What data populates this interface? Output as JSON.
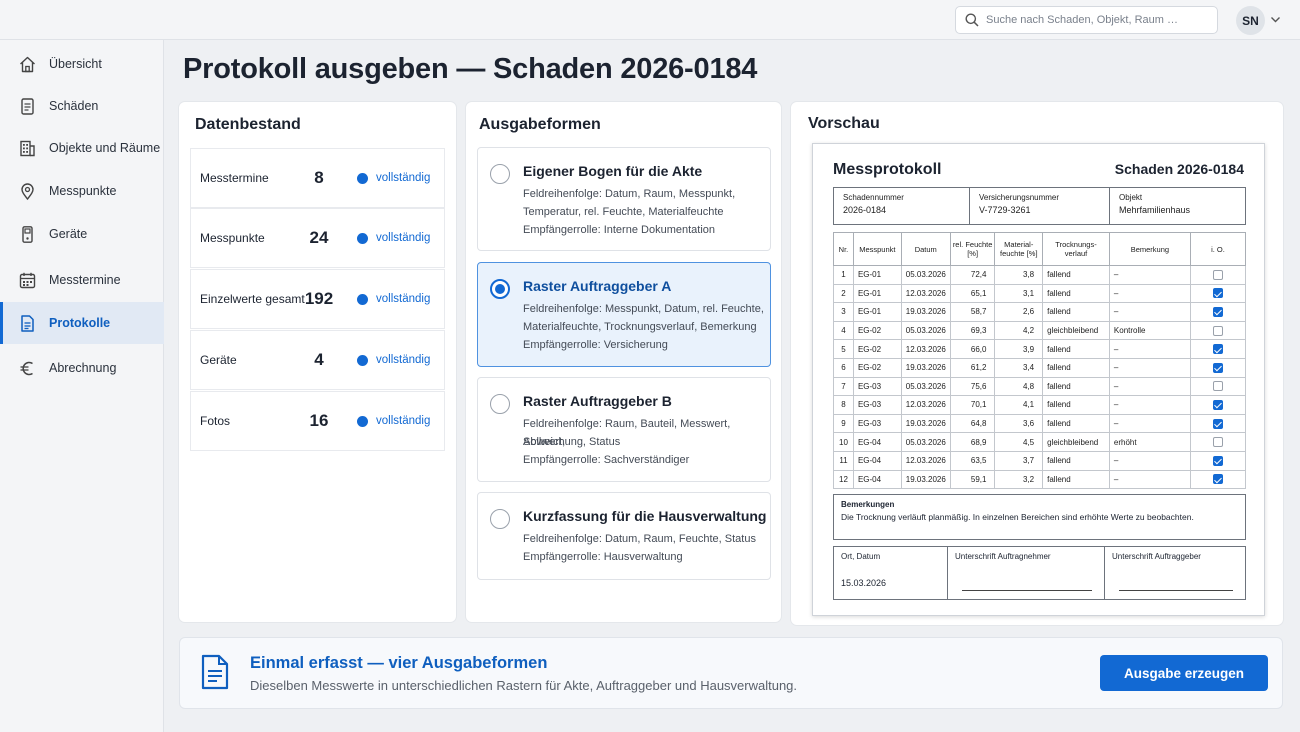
{
  "search": {
    "placeholder": "Suche nach Schaden, Objekt, Raum …"
  },
  "user": {
    "initials": "SN"
  },
  "sidebar": {
    "items": [
      {
        "label": "Übersicht",
        "icon": "home-icon"
      },
      {
        "label": "Schäden",
        "icon": "document-icon"
      },
      {
        "label": "Objekte und Räume",
        "icon": "building-icon"
      },
      {
        "label": "Messpunkte",
        "icon": "location-pin-icon"
      },
      {
        "label": "Geräte",
        "icon": "device-icon"
      },
      {
        "label": "Messtermine",
        "icon": "calendar-icon"
      },
      {
        "label": "Protokolle",
        "icon": "protocol-icon",
        "active": true
      },
      {
        "label": "Abrechnung",
        "icon": "euro-icon"
      }
    ]
  },
  "page": {
    "title": "Protokoll ausgeben — Schaden 2026-0184"
  },
  "datenbestand": {
    "title": "Datenbestand",
    "rows": [
      {
        "label": "Messtermine",
        "value": "8",
        "status": "vollständig"
      },
      {
        "label": "Messpunkte",
        "value": "24",
        "status": "vollständig"
      },
      {
        "label": "Einzelwerte gesamt",
        "value": "192",
        "status": "vollständig"
      },
      {
        "label": "Geräte",
        "value": "4",
        "status": "vollständig"
      },
      {
        "label": "Fotos",
        "value": "16",
        "status": "vollständig"
      }
    ]
  },
  "ausgabeformen": {
    "title": "Ausgabeformen",
    "options": [
      {
        "title": "Eigener Bogen für die Akte",
        "fields_1": "Feldreihenfolge: Datum, Raum, Messpunkt,",
        "fields_2": "Temperatur, rel. Feuchte, Materialfeuchte",
        "role": "Empfängerrolle: Interne Dokumentation",
        "selected": false
      },
      {
        "title": "Raster Auftraggeber A",
        "fields_1": "Feldreihenfolge: Messpunkt, Datum, rel. Feuchte,",
        "fields_2": "Materialfeuchte, Trocknungsverlauf, Bemerkung",
        "role": "Empfängerrolle: Versicherung",
        "selected": true
      },
      {
        "title": "Raster Auftraggeber B",
        "fields_1": "Feldreihenfolge: Raum, Bauteil, Messwert, Sollwert,",
        "fields_2": "Abweichung, Status",
        "role": "Empfängerrolle: Sachverständiger",
        "selected": false
      },
      {
        "title": "Kurzfassung für die Hausverwaltung",
        "fields_1": "Feldreihenfolge: Datum, Raum, Feuchte, Status",
        "fields_2": "",
        "role": "Empfängerrolle: Hausverwaltung",
        "selected": false
      }
    ]
  },
  "preview": {
    "title": "Vorschau",
    "doc_title": "Messprotokoll",
    "doc_case": "Schaden 2026-0184",
    "meta": [
      {
        "key": "Schadennummer",
        "value": "2026-0184"
      },
      {
        "key": "Versicherungsnummer",
        "value": "V-7729-3261"
      },
      {
        "key": "Objekt",
        "value": "Mehrfamilienhaus"
      }
    ],
    "columns": [
      "Nr.",
      "Messpunkt",
      "Datum",
      "rel. Feuchte [%]",
      "Material-feuchte [%]",
      "Trocknungs-verlauf",
      "Bemerkung",
      "i. O."
    ],
    "rows": [
      {
        "nr": "1",
        "mp": "EG-01",
        "date": "05.03.2026",
        "rh": "72,4",
        "mf": "3,8",
        "trend": "fallend",
        "note": "–",
        "ok": false
      },
      {
        "nr": "2",
        "mp": "EG-01",
        "date": "12.03.2026",
        "rh": "65,1",
        "mf": "3,1",
        "trend": "fallend",
        "note": "–",
        "ok": true
      },
      {
        "nr": "3",
        "mp": "EG-01",
        "date": "19.03.2026",
        "rh": "58,7",
        "mf": "2,6",
        "trend": "fallend",
        "note": "–",
        "ok": true
      },
      {
        "nr": "4",
        "mp": "EG-02",
        "date": "05.03.2026",
        "rh": "69,3",
        "mf": "4,2",
        "trend": "gleichbleibend",
        "note": "Kontrolle",
        "ok": false
      },
      {
        "nr": "5",
        "mp": "EG-02",
        "date": "12.03.2026",
        "rh": "66,0",
        "mf": "3,9",
        "trend": "fallend",
        "note": "–",
        "ok": true
      },
      {
        "nr": "6",
        "mp": "EG-02",
        "date": "19.03.2026",
        "rh": "61,2",
        "mf": "3,4",
        "trend": "fallend",
        "note": "–",
        "ok": true
      },
      {
        "nr": "7",
        "mp": "EG-03",
        "date": "05.03.2026",
        "rh": "75,6",
        "mf": "4,8",
        "trend": "fallend",
        "note": "–",
        "ok": false
      },
      {
        "nr": "8",
        "mp": "EG-03",
        "date": "12.03.2026",
        "rh": "70,1",
        "mf": "4,1",
        "trend": "fallend",
        "note": "–",
        "ok": true
      },
      {
        "nr": "9",
        "mp": "EG-03",
        "date": "19.03.2026",
        "rh": "64,8",
        "mf": "3,6",
        "trend": "fallend",
        "note": "–",
        "ok": true
      },
      {
        "nr": "10",
        "mp": "EG-04",
        "date": "05.03.2026",
        "rh": "68,9",
        "mf": "4,5",
        "trend": "gleichbleibend",
        "note": "erhöht",
        "ok": false
      },
      {
        "nr": "11",
        "mp": "EG-04",
        "date": "12.03.2026",
        "rh": "63,5",
        "mf": "3,7",
        "trend": "fallend",
        "note": "–",
        "ok": true
      },
      {
        "nr": "12",
        "mp": "EG-04",
        "date": "19.03.2026",
        "rh": "59,1",
        "mf": "3,2",
        "trend": "fallend",
        "note": "–",
        "ok": true
      }
    ],
    "remarks_label": "Bemerkungen",
    "remarks_text": "Die Trocknung verläuft planmäßig. In einzelnen Bereichen sind erhöhte Werte zu beobachten.",
    "sign_place_label": "Ort, Datum",
    "sign_place_value": "15.03.2026",
    "sign_contractor_label": "Unterschrift Auftragnehmer",
    "sign_client_label": "Unterschrift Auftraggeber"
  },
  "banner": {
    "title": "Einmal erfasst — vier Ausgabeformen",
    "subtitle": "Dieselben Messwerte in unterschiedlichen Rastern für Akte, Auftraggeber und Hausverwaltung."
  },
  "actions": {
    "generate_label": "Ausgabe erzeugen"
  },
  "colors": {
    "accent": "#1269d3",
    "selected_bg": "#e9f2fc",
    "background": "#eef0f3"
  }
}
